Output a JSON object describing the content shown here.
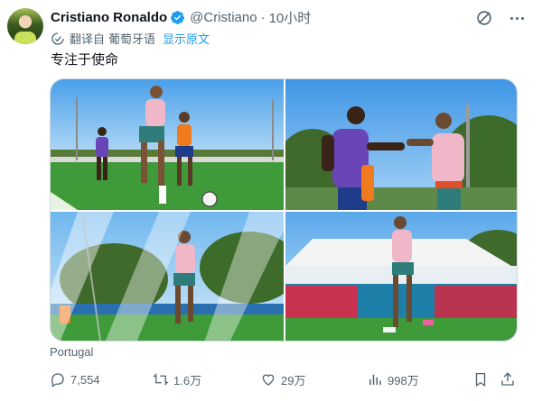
{
  "author": {
    "name": "Cristiano Ronaldo",
    "handle": "@Cristiano",
    "separator": "·",
    "time": "10小时"
  },
  "translation": {
    "prefix": "翻译自",
    "language": "葡萄牙语",
    "show_original": "显示原文"
  },
  "tweet_text": "专注于使命",
  "location": "Portugal",
  "stats": {
    "replies": "7,554",
    "retweets": "1.6万",
    "likes": "29万",
    "views": "998万"
  },
  "colors": {
    "accent": "#1d9bf0",
    "muted": "#536471",
    "pitch": "#3f9a3a",
    "sky": "#6fb7ee"
  },
  "icons": [
    "verified-badge-icon",
    "grok-icon",
    "more-icon",
    "translate-icon",
    "reply-icon",
    "retweet-icon",
    "like-icon",
    "views-icon",
    "bookmark-icon",
    "share-icon"
  ]
}
